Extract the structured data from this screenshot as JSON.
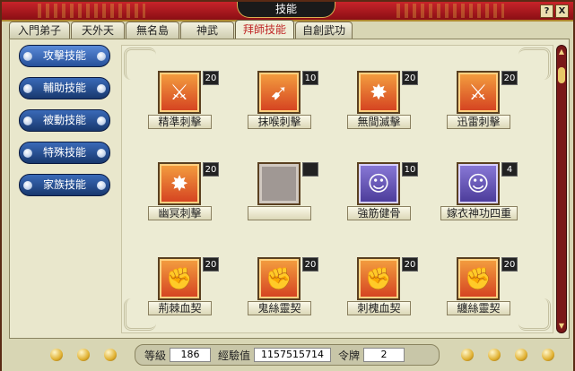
{
  "window": {
    "title": "技能",
    "help_label": "?",
    "close_label": "X"
  },
  "tabs": [
    {
      "label": "入門弟子"
    },
    {
      "label": "天外天"
    },
    {
      "label": "無名島"
    },
    {
      "label": "神武"
    },
    {
      "label": "拜師技能"
    },
    {
      "label": "自創武功"
    }
  ],
  "active_tab": 4,
  "sidebar": [
    {
      "label": "攻擊技能"
    },
    {
      "label": "輔助技能"
    },
    {
      "label": "被動技能"
    },
    {
      "label": "特殊技能"
    },
    {
      "label": "家族技能"
    }
  ],
  "skills": [
    {
      "name": "精準刺擊",
      "level": "20",
      "icon": "red-dagger-icon",
      "style": "red"
    },
    {
      "name": "抹喉刺擊",
      "level": "10",
      "icon": "red-slash-icon",
      "style": "red"
    },
    {
      "name": "無間滅擊",
      "level": "20",
      "icon": "red-burst-icon",
      "style": "red"
    },
    {
      "name": "迅雷刺擊",
      "level": "20",
      "icon": "red-dagger-icon",
      "style": "red"
    },
    {
      "name": "幽冥刺擊",
      "level": "20",
      "icon": "red-burst-icon",
      "style": "red"
    },
    {
      "name": "",
      "level": "",
      "icon": "empty-slot-icon",
      "style": "empty"
    },
    {
      "name": "強筋健骨",
      "level": "10",
      "icon": "strength-buff-icon",
      "style": "purple"
    },
    {
      "name": "嫁衣神功四重",
      "level": "4",
      "icon": "strength-buff-icon",
      "style": "purple"
    },
    {
      "name": "荊棘血契",
      "level": "20",
      "icon": "fire-fist-icon",
      "style": "red"
    },
    {
      "name": "鬼絲靈契",
      "level": "20",
      "icon": "spirit-fist-icon",
      "style": "red"
    },
    {
      "name": "刺槐血契",
      "level": "20",
      "icon": "fire-fist-icon",
      "style": "red"
    },
    {
      "name": "纏絲靈契",
      "level": "20",
      "icon": "spirit-fist-icon",
      "style": "red"
    }
  ],
  "stats": {
    "level_label": "等級",
    "level": "186",
    "exp_label": "經驗值",
    "exp": "1157515714",
    "token_label": "令牌",
    "token": "2"
  }
}
